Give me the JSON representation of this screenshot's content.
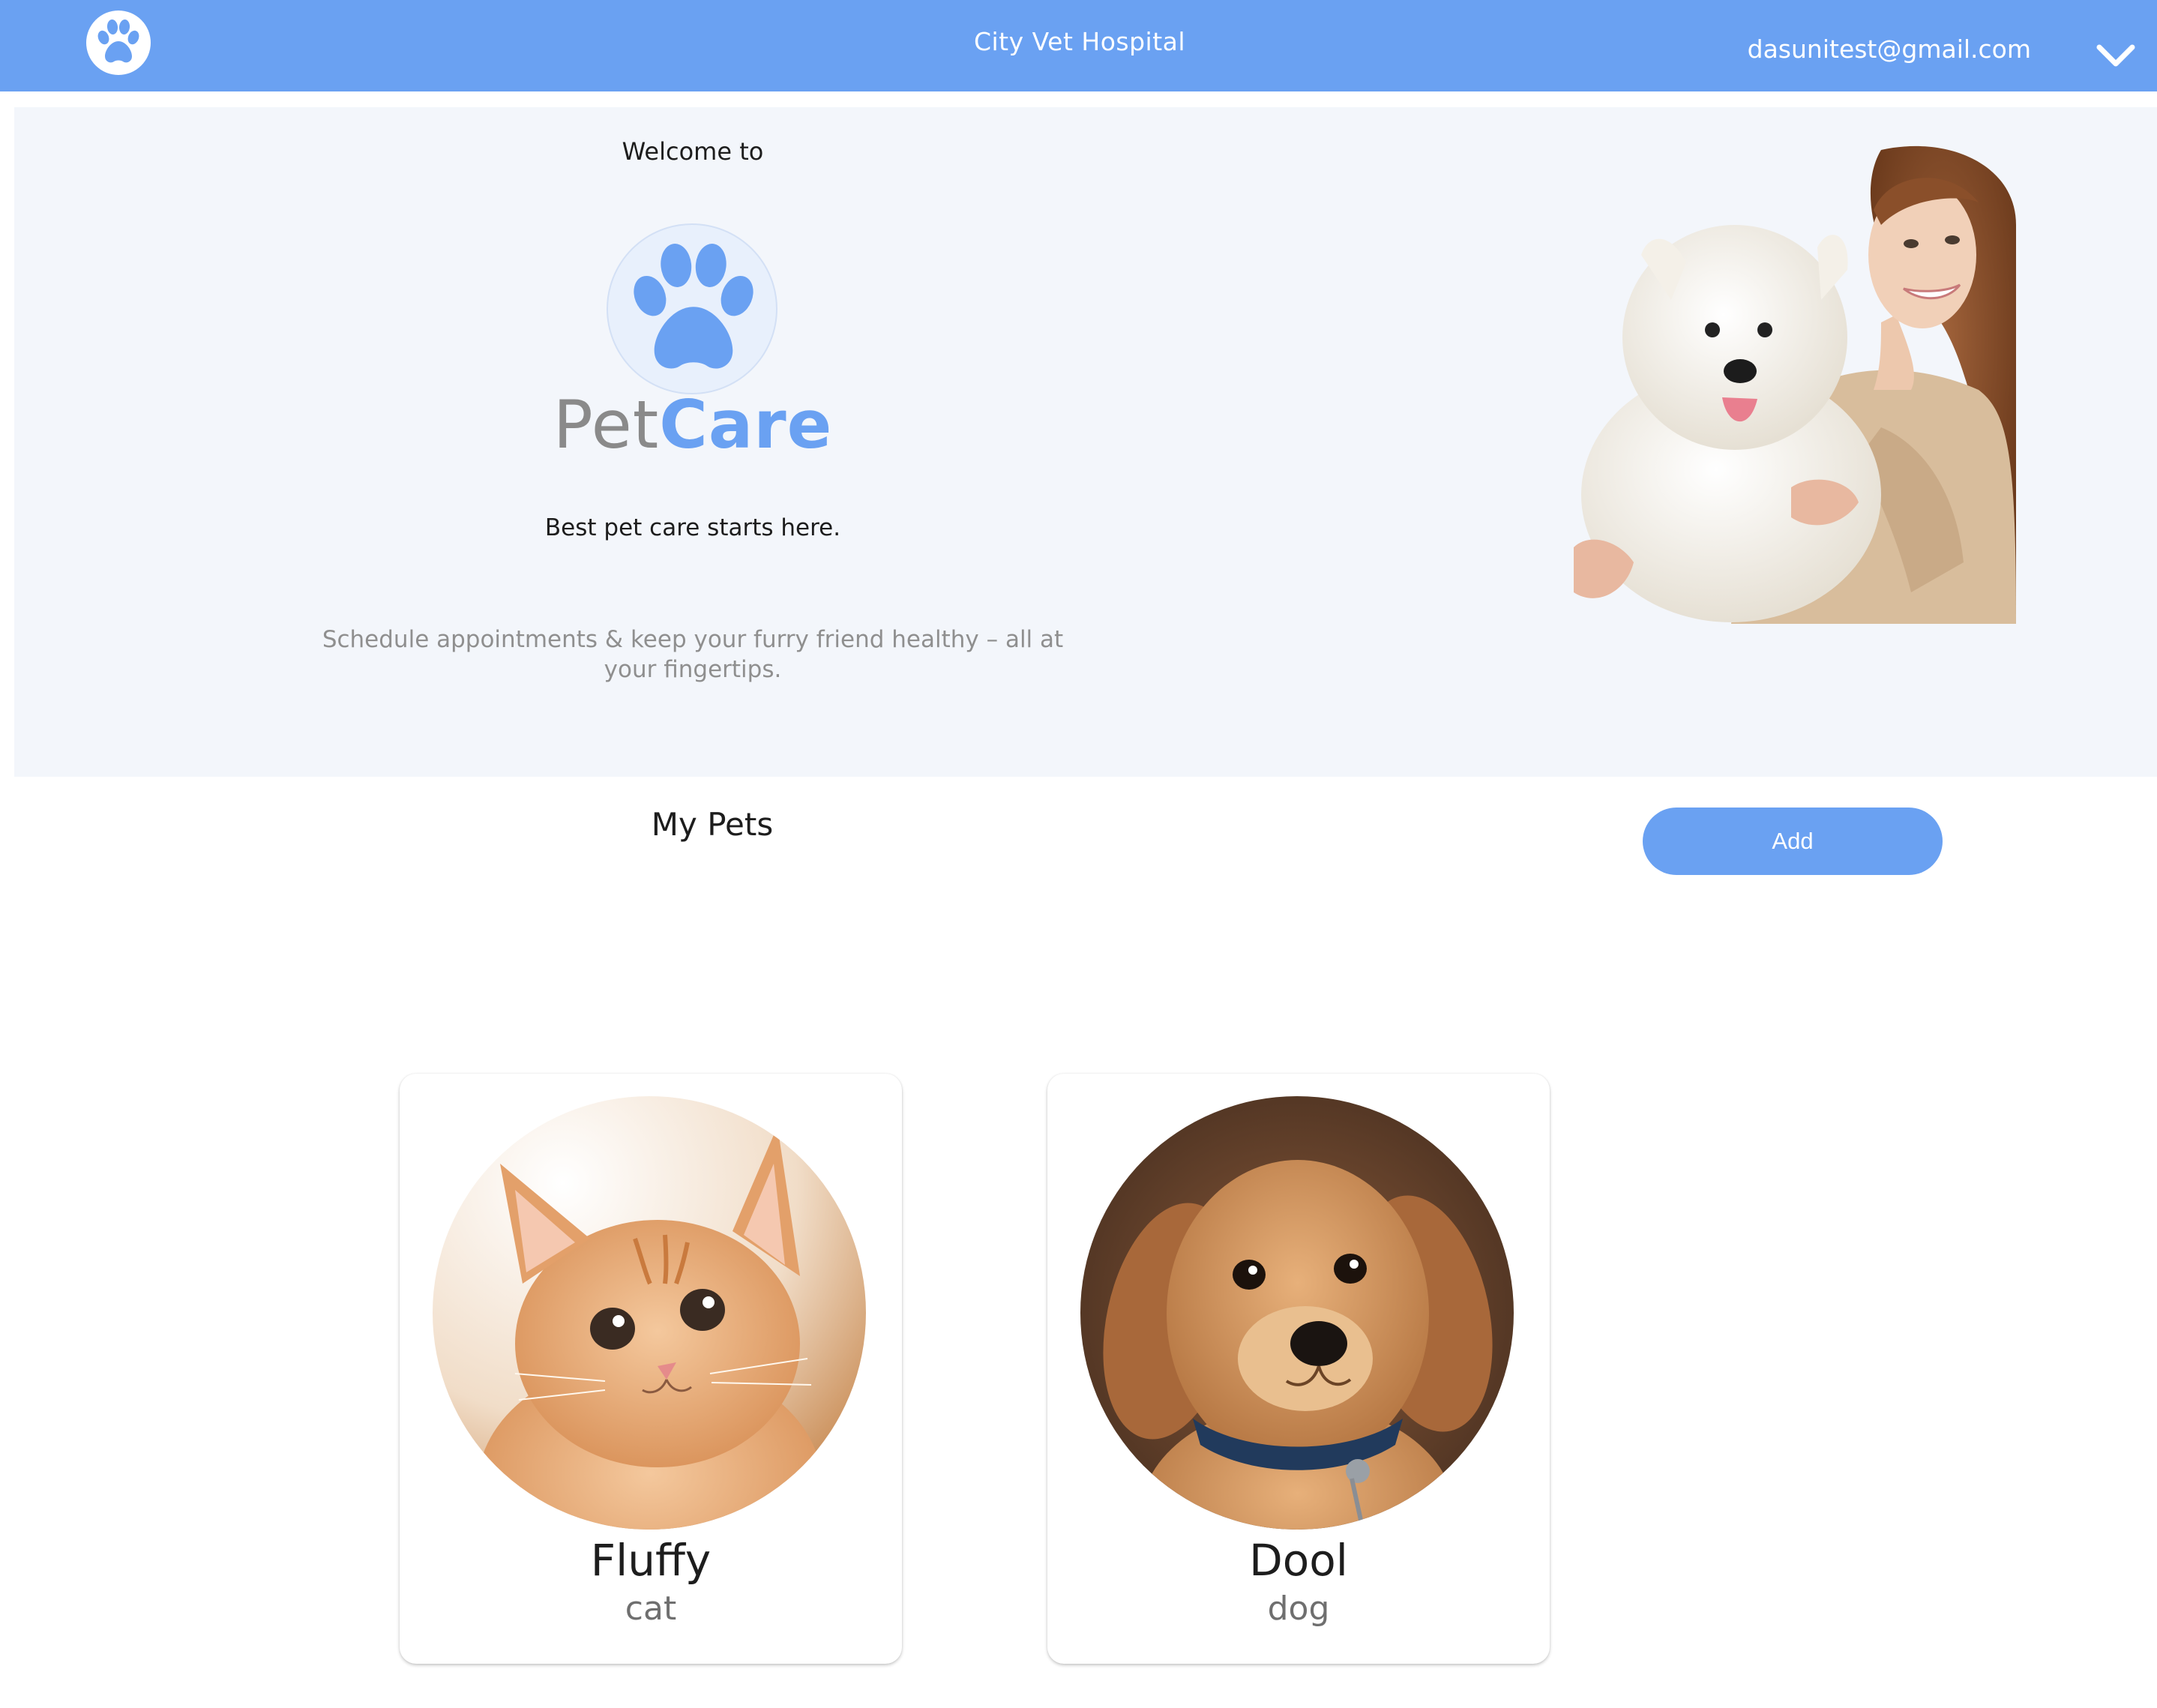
{
  "header": {
    "logo_icon": "paw-icon",
    "title": "City Vet Hospital",
    "user_email": "dasunitest@gmail.com",
    "menu_icon": "chevron-down-icon",
    "background_color": "#6aa1f2"
  },
  "hero": {
    "welcome": "Welcome to",
    "brand_light": "Pet",
    "brand_bold": "Care",
    "tagline": "Best pet care starts here.",
    "description": "Schedule appointments & keep your furry friend healthy – all at your fingertips.",
    "background_color": "#f3f6fb",
    "photo": "woman-holding-white-dog-photo"
  },
  "pets_section": {
    "title": "My Pets",
    "add_label": "Add"
  },
  "pets": [
    {
      "name": "Fluffy",
      "species": "cat",
      "photo": "kitten-photo"
    },
    {
      "name": "Dool",
      "species": "dog",
      "photo": "puppy-photo"
    }
  ],
  "colors": {
    "accent": "#6aa1f2",
    "brand_gray": "#8a8a8a"
  }
}
